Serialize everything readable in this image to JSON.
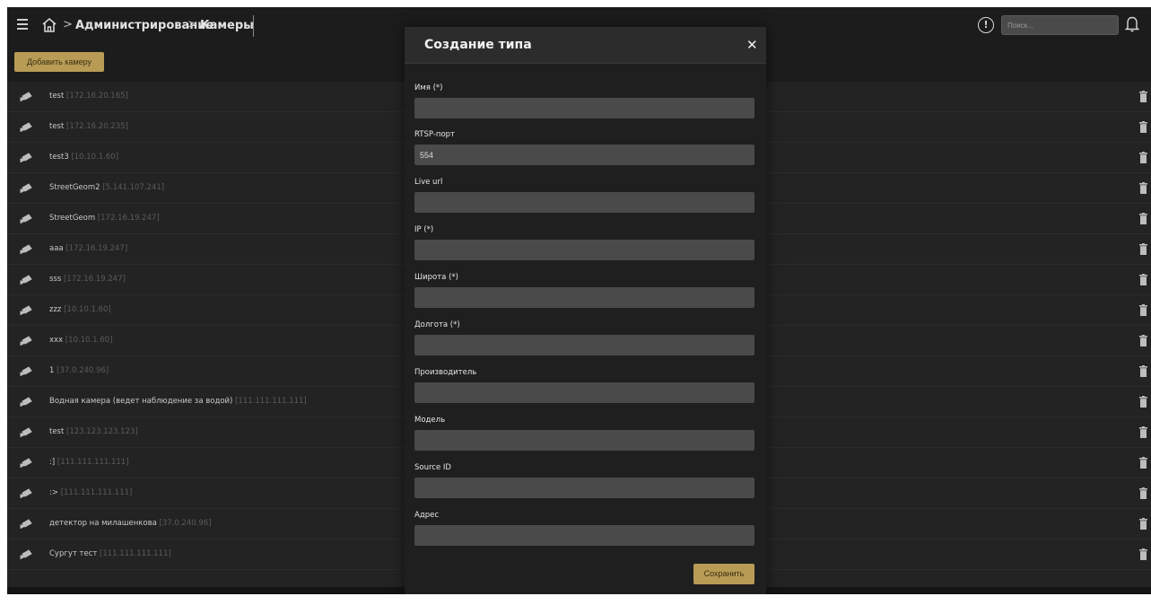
{
  "header": {
    "breadcrumb": [
      "Администрирование",
      "Камеры"
    ],
    "separator": ">",
    "search_placeholder": "Поиск...",
    "icons": [
      "menu-icon",
      "home-icon",
      "alert-icon",
      "bell-icon"
    ],
    "alert_glyph": "!"
  },
  "toolbar": {
    "add_label": "Добавить камеру"
  },
  "cameras": [
    {
      "name": "test",
      "ip": "[172.16.20.165]"
    },
    {
      "name": "test",
      "ip": "[172.16.20.235]"
    },
    {
      "name": "test3",
      "ip": "[10.10.1.60]"
    },
    {
      "name": "StreetGeom2",
      "ip": "[5.141.107.241]"
    },
    {
      "name": "StreetGeom",
      "ip": "[172.16.19.247]"
    },
    {
      "name": "aaa",
      "ip": "[172.16.19.247]"
    },
    {
      "name": "sss",
      "ip": "[172.16.19.247]"
    },
    {
      "name": "zzz",
      "ip": "[10.10.1.60]"
    },
    {
      "name": "xxx",
      "ip": "[10.10.1.60]"
    },
    {
      "name": "1",
      "ip": "[37.0.240.96]"
    },
    {
      "name": "Водная камера (ведет наблюдение за водой)",
      "ip": "[111.111.111.111]"
    },
    {
      "name": "test",
      "ip": "[123.123.123.123]"
    },
    {
      "name": ":]",
      "ip": "[111.111.111.111]"
    },
    {
      "name": ":>",
      "ip": "[111.111.111.111]"
    },
    {
      "name": "детектор на милашенкова",
      "ip": "[37.0.240.96]"
    },
    {
      "name": "Сургут тест",
      "ip": "[111.111.111.111]"
    }
  ],
  "modal": {
    "title": "Создание типа",
    "close_glyph": "✕",
    "fields": [
      {
        "label": "Имя (*)",
        "value": ""
      },
      {
        "label": "RTSP-порт",
        "value": "554"
      },
      {
        "label": "Live url",
        "value": ""
      },
      {
        "label": "IP (*)",
        "value": ""
      },
      {
        "label": "Широта (*)",
        "value": ""
      },
      {
        "label": "Долгота (*)",
        "value": ""
      },
      {
        "label": "Производитель",
        "value": ""
      },
      {
        "label": "Модель",
        "value": ""
      },
      {
        "label": "Source ID",
        "value": ""
      },
      {
        "label": "Адрес",
        "value": ""
      }
    ],
    "save_label": "Сохранить"
  },
  "colors": {
    "accent": "#b89c55",
    "background": "#232323",
    "input": "#4a4a4a",
    "ip_text": "#5b5b5b"
  }
}
